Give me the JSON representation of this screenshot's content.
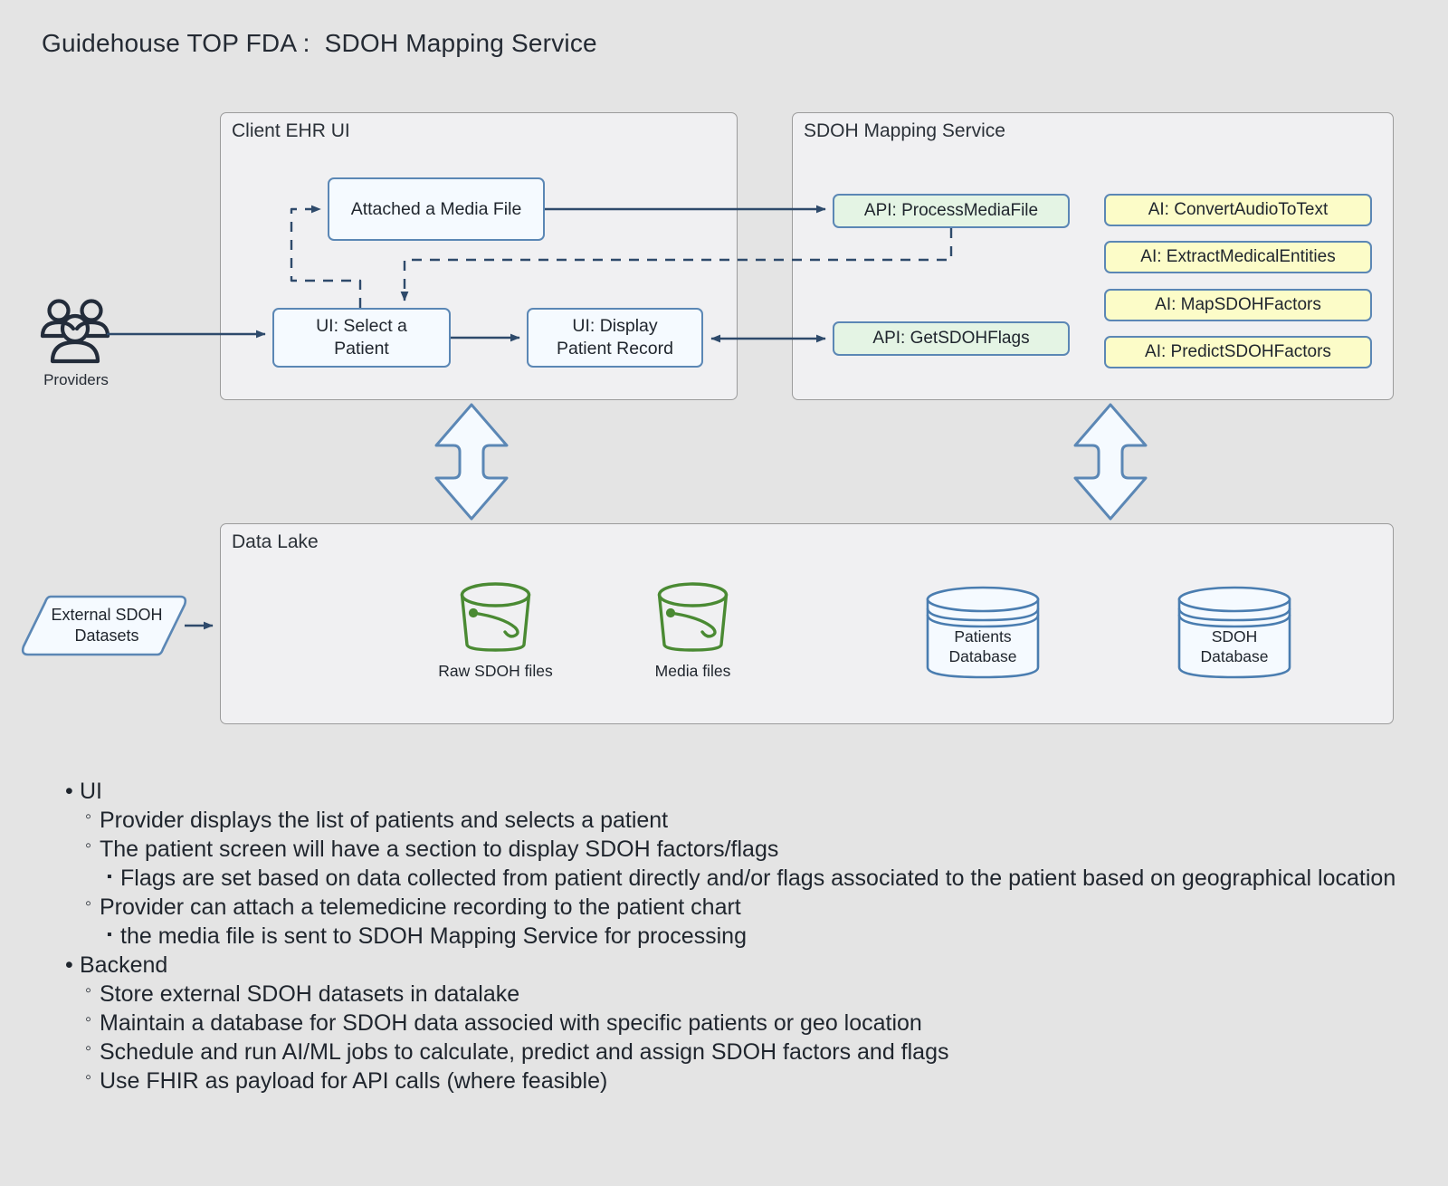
{
  "page": {
    "title": "Guidehouse TOP FDA :  SDOH Mapping Service",
    "background_color": "#e4e4e4"
  },
  "colors": {
    "node_border": "#5b87b5",
    "node_fill": "#f5faff",
    "api_fill": "#e4f4e4",
    "ai_fill": "#fcfcc8",
    "container_fill": "#f0f0f2",
    "container_border": "#9b9b9b",
    "arrow": "#2e4a6b",
    "bucket": "#4a8a33",
    "cylinder": "#4a7db0",
    "actor": "#232c3a",
    "text": "#1f252d"
  },
  "actors": [
    {
      "id": "providers",
      "label": "Providers",
      "icon": "people-group-icon"
    }
  ],
  "external_inputs": [
    {
      "id": "external-sdoh-datasets",
      "label": "External SDOH\nDatasets",
      "shape": "parallelogram"
    }
  ],
  "containers": [
    {
      "id": "client-ehr-ui",
      "title": "Client EHR UI",
      "nodes": [
        {
          "id": "attached-media-file",
          "label": "Attached a Media File",
          "kind": "ui"
        },
        {
          "id": "ui-select-patient",
          "label": "UI: Select a\nPatient",
          "kind": "ui"
        },
        {
          "id": "ui-display-patient-record",
          "label": "UI: Display\nPatient Record",
          "kind": "ui"
        }
      ]
    },
    {
      "id": "sdoh-mapping-service",
      "title": "SDOH Mapping Service",
      "nodes": [
        {
          "id": "api-process-media-file",
          "label": "API: ProcessMediaFile",
          "kind": "api"
        },
        {
          "id": "api-get-sdoh-flags",
          "label": "API: GetSDOHFlags",
          "kind": "api"
        },
        {
          "id": "ai-convert-audio-to-text",
          "label": "AI: ConvertAudioToText",
          "kind": "ai"
        },
        {
          "id": "ai-extract-medical-entities",
          "label": "AI: ExtractMedicalEntities",
          "kind": "ai"
        },
        {
          "id": "ai-map-sdoh-factors",
          "label": "AI: MapSDOHFactors",
          "kind": "ai"
        },
        {
          "id": "ai-predict-sdoh-factors",
          "label": "AI: PredictSDOHFactors",
          "kind": "ai"
        }
      ]
    },
    {
      "id": "data-lake",
      "title": "Data Lake",
      "artifacts": [
        {
          "id": "raw-sdoh-files",
          "label": "Raw SDOH files",
          "icon": "bucket-icon"
        },
        {
          "id": "media-files",
          "label": "Media files",
          "icon": "bucket-icon"
        },
        {
          "id": "patients-database",
          "label": "Patients\nDatabase",
          "icon": "database-cylinder-icon"
        },
        {
          "id": "sdoh-database",
          "label": "SDOH\nDatabase",
          "icon": "database-cylinder-icon"
        }
      ]
    }
  ],
  "connectors": [
    {
      "id": "providers-to-select-patient",
      "from": "providers",
      "to": "ui-select-patient",
      "style": "solid",
      "arrows": "end"
    },
    {
      "id": "select-patient-to-attached-media",
      "from": "ui-select-patient",
      "to": "attached-media-file",
      "style": "dashed",
      "arrows": "end"
    },
    {
      "id": "select-patient-to-display-record",
      "from": "ui-select-patient",
      "to": "ui-display-patient-record",
      "style": "solid",
      "arrows": "end"
    },
    {
      "id": "attached-media-to-process-media-file",
      "from": "attached-media-file",
      "to": "api-process-media-file",
      "style": "solid",
      "arrows": "end"
    },
    {
      "id": "process-media-file-to-select-patient",
      "from": "api-process-media-file",
      "to": "ui-select-patient",
      "style": "dashed",
      "arrows": "end"
    },
    {
      "id": "display-record-to-get-sdoh-flags",
      "from": "ui-display-patient-record",
      "to": "api-get-sdoh-flags",
      "style": "solid",
      "arrows": "both"
    },
    {
      "id": "external-datasets-to-data-lake",
      "from": "external-sdoh-datasets",
      "to": "data-lake",
      "style": "solid",
      "arrows": "end"
    },
    {
      "id": "client-ehr-ui-to-data-lake",
      "from": "client-ehr-ui",
      "to": "data-lake",
      "style": "block",
      "arrows": "both"
    },
    {
      "id": "sdoh-service-to-data-lake",
      "from": "sdoh-mapping-service",
      "to": "data-lake",
      "style": "block",
      "arrows": "both"
    }
  ],
  "notes": [
    {
      "level": 1,
      "bullet": "•",
      "text": "UI"
    },
    {
      "level": 2,
      "bullet": "◦",
      "text": "Provider displays the list of patients and selects a patient"
    },
    {
      "level": 2,
      "bullet": "◦",
      "text": "The patient screen will have a section to display SDOH factors/flags"
    },
    {
      "level": 3,
      "bullet": "▪",
      "text": "Flags are set based on data collected from patient directly and/or flags associated to the patient based on geographical location"
    },
    {
      "level": 2,
      "bullet": "◦",
      "text": "Provider can attach a telemedicine recording to the patient chart"
    },
    {
      "level": 3,
      "bullet": "▪",
      "text": "the media file is sent to SDOH Mapping Service for processing"
    },
    {
      "level": 1,
      "bullet": "•",
      "text": "Backend"
    },
    {
      "level": 2,
      "bullet": "◦",
      "text": "Store external SDOH datasets in datalake"
    },
    {
      "level": 2,
      "bullet": "◦",
      "text": "Maintain a database for SDOH data associed with specific patients or geo location"
    },
    {
      "level": 2,
      "bullet": "◦",
      "text": "Schedule and run AI/ML jobs to calculate, predict and assign SDOH factors and flags"
    },
    {
      "level": 2,
      "bullet": "◦",
      "text": "Use FHIR as payload for API calls (where feasible)"
    }
  ]
}
